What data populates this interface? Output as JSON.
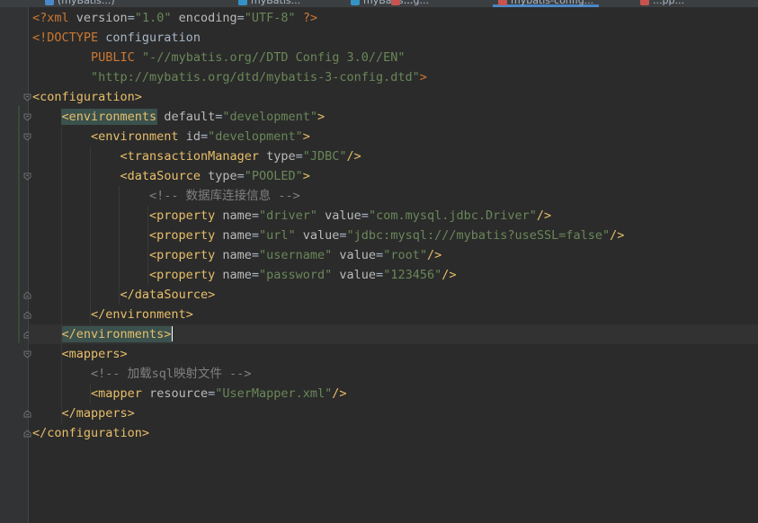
{
  "tabs": [
    {
      "label": "(myBatis...)",
      "color": "#4a88c7"
    },
    {
      "label": "myBatis...",
      "color": "#3592c4"
    },
    {
      "label": "myBatis...",
      "color": "#3592c4"
    },
    {
      "label": "...g...",
      "color": "#c75450"
    },
    {
      "label": "mybatis-config...",
      "color": "#c75450",
      "active": true
    },
    {
      "label": "...pp...",
      "color": "#c75450"
    }
  ],
  "editor": {
    "lines": [
      [
        {
          "t": "decl",
          "v": "<?"
        },
        {
          "t": "decl",
          "v": "xml "
        },
        {
          "t": "attr",
          "v": "version"
        },
        {
          "t": "plain",
          "v": "="
        },
        {
          "t": "val",
          "v": "\"1.0\""
        },
        {
          "t": "plain",
          "v": " "
        },
        {
          "t": "attr",
          "v": "encoding"
        },
        {
          "t": "plain",
          "v": "="
        },
        {
          "t": "val",
          "v": "\"UTF-8\""
        },
        {
          "t": "plain",
          "v": " "
        },
        {
          "t": "decl",
          "v": "?>"
        }
      ],
      [
        {
          "t": "decl",
          "v": "<!DOCTYPE "
        },
        {
          "t": "plain",
          "v": "configuration"
        }
      ],
      [
        {
          "t": "plain",
          "v": "        "
        },
        {
          "t": "decl",
          "v": "PUBLIC "
        },
        {
          "t": "val",
          "v": "\"-//mybatis.org//DTD Config 3.0//EN\""
        }
      ],
      [
        {
          "t": "plain",
          "v": "        "
        },
        {
          "t": "val",
          "v": "\"http://mybatis.org/dtd/mybatis-3-config.dtd\""
        },
        {
          "t": "decl",
          "v": ">"
        }
      ],
      [
        {
          "t": "tag",
          "v": "<configuration>"
        }
      ],
      [
        {
          "t": "plain",
          "v": "    "
        },
        {
          "t": "tag",
          "v": "<environments",
          "hl": true
        },
        {
          "t": "plain",
          "v": " "
        },
        {
          "t": "attr",
          "v": "default"
        },
        {
          "t": "plain",
          "v": "="
        },
        {
          "t": "val",
          "v": "\"development\""
        },
        {
          "t": "tag",
          "v": ">"
        }
      ],
      [
        {
          "t": "plain",
          "v": "        "
        },
        {
          "t": "tag",
          "v": "<environment "
        },
        {
          "t": "attr",
          "v": "id"
        },
        {
          "t": "plain",
          "v": "="
        },
        {
          "t": "val",
          "v": "\"development\""
        },
        {
          "t": "tag",
          "v": ">"
        }
      ],
      [
        {
          "t": "plain",
          "v": "            "
        },
        {
          "t": "tag",
          "v": "<transactionManager "
        },
        {
          "t": "attr",
          "v": "type"
        },
        {
          "t": "plain",
          "v": "="
        },
        {
          "t": "val",
          "v": "\"JDBC\""
        },
        {
          "t": "tag",
          "v": "/>"
        }
      ],
      [
        {
          "t": "plain",
          "v": "            "
        },
        {
          "t": "tag",
          "v": "<dataSource "
        },
        {
          "t": "attr",
          "v": "type"
        },
        {
          "t": "plain",
          "v": "="
        },
        {
          "t": "val",
          "v": "\"POOLED\""
        },
        {
          "t": "tag",
          "v": ">"
        }
      ],
      [
        {
          "t": "plain",
          "v": "                "
        },
        {
          "t": "comment",
          "v": "<!-- 数据库连接信息 -->"
        }
      ],
      [
        {
          "t": "plain",
          "v": "                "
        },
        {
          "t": "tag",
          "v": "<property "
        },
        {
          "t": "attr",
          "v": "name"
        },
        {
          "t": "plain",
          "v": "="
        },
        {
          "t": "val",
          "v": "\"driver\""
        },
        {
          "t": "plain",
          "v": " "
        },
        {
          "t": "attr",
          "v": "value"
        },
        {
          "t": "plain",
          "v": "="
        },
        {
          "t": "val",
          "v": "\"com.mysql.jdbc.Driver\""
        },
        {
          "t": "tag",
          "v": "/>"
        }
      ],
      [
        {
          "t": "plain",
          "v": "                "
        },
        {
          "t": "tag",
          "v": "<property "
        },
        {
          "t": "attr",
          "v": "name"
        },
        {
          "t": "plain",
          "v": "="
        },
        {
          "t": "val",
          "v": "\"url\""
        },
        {
          "t": "plain",
          "v": " "
        },
        {
          "t": "attr",
          "v": "value"
        },
        {
          "t": "plain",
          "v": "="
        },
        {
          "t": "val",
          "v": "\"jdbc:mysql:///mybatis?useSSL=false\""
        },
        {
          "t": "tag",
          "v": "/>"
        }
      ],
      [
        {
          "t": "plain",
          "v": "                "
        },
        {
          "t": "tag",
          "v": "<property "
        },
        {
          "t": "attr",
          "v": "name"
        },
        {
          "t": "plain",
          "v": "="
        },
        {
          "t": "val",
          "v": "\"username\""
        },
        {
          "t": "plain",
          "v": " "
        },
        {
          "t": "attr",
          "v": "value"
        },
        {
          "t": "plain",
          "v": "="
        },
        {
          "t": "val",
          "v": "\"root\""
        },
        {
          "t": "tag",
          "v": "/>"
        }
      ],
      [
        {
          "t": "plain",
          "v": "                "
        },
        {
          "t": "tag",
          "v": "<property "
        },
        {
          "t": "attr",
          "v": "name"
        },
        {
          "t": "plain",
          "v": "="
        },
        {
          "t": "val",
          "v": "\"password\""
        },
        {
          "t": "plain",
          "v": " "
        },
        {
          "t": "attr",
          "v": "value"
        },
        {
          "t": "plain",
          "v": "="
        },
        {
          "t": "val",
          "v": "\"123456\""
        },
        {
          "t": "tag",
          "v": "/>"
        }
      ],
      [
        {
          "t": "plain",
          "v": "            "
        },
        {
          "t": "tag",
          "v": "</dataSource>"
        }
      ],
      [
        {
          "t": "plain",
          "v": "        "
        },
        {
          "t": "tag",
          "v": "</environment>"
        }
      ],
      [
        {
          "t": "plain",
          "v": "    "
        },
        {
          "t": "tag",
          "v": "</environments>",
          "hl": true,
          "caret": true
        }
      ],
      [
        {
          "t": "plain",
          "v": "    "
        },
        {
          "t": "tag",
          "v": "<mappers>"
        }
      ],
      [
        {
          "t": "plain",
          "v": "        "
        },
        {
          "t": "comment",
          "v": "<!-- 加载sql映射文件 -->"
        }
      ],
      [
        {
          "t": "plain",
          "v": "        "
        },
        {
          "t": "tag",
          "v": "<mapper "
        },
        {
          "t": "attr",
          "v": "resource"
        },
        {
          "t": "plain",
          "v": "="
        },
        {
          "t": "val",
          "v": "\"UserMapper.xml\""
        },
        {
          "t": "tag",
          "v": "/>"
        }
      ],
      [
        {
          "t": "plain",
          "v": "    "
        },
        {
          "t": "tag",
          "v": "</mappers>"
        }
      ],
      [
        {
          "t": "tag",
          "v": "</configuration>"
        }
      ]
    ],
    "current_line": 17,
    "colors": {
      "background": "#2b2b2b",
      "tag": "#e8bf6a",
      "attribute": "#bababa",
      "value": "#6a8759",
      "comment": "#808080",
      "keyword": "#cc7832",
      "match_highlight": "#3b514d"
    }
  },
  "gutter": {
    "fold_open_lines": [
      5,
      6,
      7,
      9
    ],
    "fold_close_lines": [
      15,
      16,
      17,
      21,
      22
    ],
    "fold_open_extra": [
      18
    ],
    "intention_icon": "lightbulb-icon"
  }
}
